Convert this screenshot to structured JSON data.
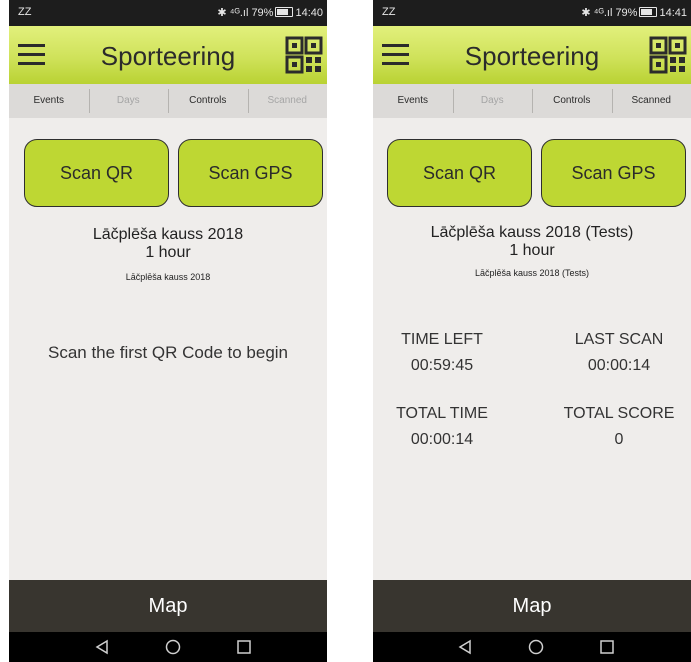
{
  "screens": [
    {
      "status": {
        "carrier": "ZZ",
        "icons": "✱ ⁴ᴳ.ıl",
        "battery": "79%",
        "time": "14:40"
      },
      "app_title": "Sporteering",
      "tabs": [
        "Events",
        "Days",
        "Controls",
        "Scanned"
      ],
      "buttons": {
        "scan_qr": "Scan QR",
        "scan_gps": "Scan GPS"
      },
      "event": {
        "title": "Lāčplēša kauss 2018",
        "duration": "1 hour",
        "subtitle": "Lāčplēša kauss 2018"
      },
      "message": "Scan the first QR Code to begin",
      "map_label": "Map"
    },
    {
      "status": {
        "carrier": "ZZ",
        "icons": "✱ ⁴ᴳ.ıl",
        "battery": "79%",
        "time": "14:41"
      },
      "app_title": "Sporteering",
      "tabs": [
        "Events",
        "Days",
        "Controls",
        "Scanned"
      ],
      "buttons": {
        "scan_qr": "Scan QR",
        "scan_gps": "Scan GPS"
      },
      "event": {
        "title": "Lāčplēša kauss 2018 (Tests)",
        "duration": "1 hour",
        "subtitle": "Lāčplēša kauss 2018 (Tests)"
      },
      "stats": {
        "time_left_label": "TIME LEFT",
        "time_left": "00:59:45",
        "last_scan_label": "LAST SCAN",
        "last_scan": "00:00:14",
        "total_time_label": "TOTAL TIME",
        "total_time": "00:00:14",
        "total_score_label": "TOTAL SCORE",
        "total_score": "0"
      },
      "map_label": "Map"
    }
  ]
}
